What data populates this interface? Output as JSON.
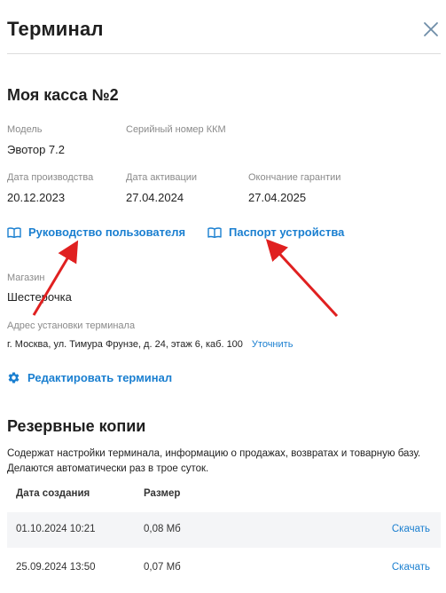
{
  "header": {
    "title": "Терминал"
  },
  "terminal": {
    "name": "Моя касса №2",
    "model_label": "Модель",
    "model_value": "Эвотор 7.2",
    "serial_label": "Серийный номер ККМ",
    "prod_date_label": "Дата производства",
    "prod_date_value": "20.12.2023",
    "activation_label": "Дата активации",
    "activation_value": "27.04.2024",
    "warranty_label": "Окончание гарантии",
    "warranty_value": "27.04.2025"
  },
  "links": {
    "user_guide": "Руководство пользователя",
    "device_passport": "Паспорт устройства"
  },
  "store": {
    "label": "Магазин",
    "value": "Шестерочка",
    "address_label": "Адрес установки терминала",
    "address_value": "г. Москва, ул. Тимура Фрунзе, д. 24, этаж 6, каб. 100",
    "clarify_link": "Уточнить"
  },
  "edit_link": "Редактировать терминал",
  "backups": {
    "title": "Резервные копии",
    "description": "Содержат настройки терминала, информацию о продажах, возвратах и товарную базу. Делаются автоматически раз в трое суток.",
    "columns": [
      "Дата создания",
      "Размер"
    ],
    "rows": [
      {
        "date": "01.10.2024 10:21",
        "size": "0,08 Мб",
        "action": "Скачать"
      },
      {
        "date": "25.09.2024 13:50",
        "size": "0,07 Мб",
        "action": "Скачать"
      }
    ]
  },
  "colors": {
    "accent": "#1a7fd0",
    "annotation_arrow": "#e02020",
    "row_alt": "#f4f5f7"
  },
  "icons": [
    "close-icon",
    "book-icon",
    "gear-icon"
  ]
}
